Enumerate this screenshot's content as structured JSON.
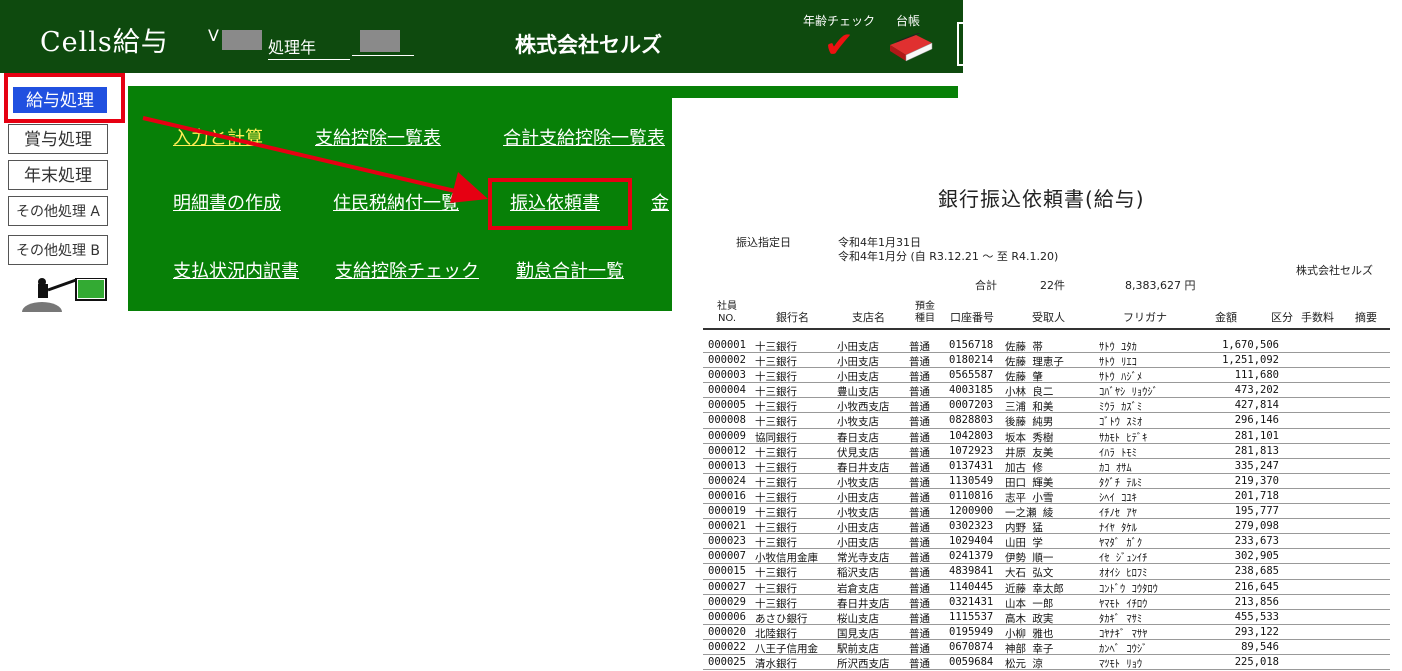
{
  "header": {
    "app_title": "Cells給与",
    "version_prefix": "V",
    "year_label": "処理年",
    "company": "株式会社セルズ",
    "age_check_label": "年齢チェック",
    "age_check_icon": "check-icon",
    "ledger_label": "台帳",
    "ledger_icon": "binder-icon"
  },
  "sidebar": {
    "items": [
      {
        "label": "給与処理",
        "active": true
      },
      {
        "label": "賞与処理"
      },
      {
        "label": "年末処理"
      },
      {
        "label": "その他処理 A"
      },
      {
        "label": "その他処理 B"
      }
    ]
  },
  "menu": {
    "row1": [
      "入力と計算",
      "支給控除一覧表",
      "合計支給控除一覧表"
    ],
    "row2": [
      "明細書の作成",
      "住民税納付一覧",
      "振込依頼書",
      "金"
    ],
    "row3": [
      "支払状況内訳書",
      "支給控除チェック",
      "勤怠合計一覧"
    ]
  },
  "colors": {
    "header_bg": "#0e4a0e",
    "menu_bg": "#078007",
    "highlight": "#e60012",
    "active_button": "#2050e0"
  },
  "report": {
    "title": "銀行振込依頼書(給与)",
    "date_label": "振込指定日",
    "date_value": "令和4年1月31日",
    "period": "令和4年1月分 (自 R3.12.21 ～ 至 R4.1.20)",
    "company": "株式会社セルズ",
    "total_label": "合計",
    "total_count": "22件",
    "total_amount": "8,383,627 円",
    "columns": [
      "社員NO.",
      "銀行名",
      "支店名",
      "預金種目",
      "口座番号",
      "受取人",
      "フリガナ",
      "金額",
      "区分",
      "手数料",
      "摘要"
    ],
    "rows": [
      [
        "000001",
        "十三銀行",
        "小田支店",
        "普通",
        "0156718",
        "佐藤 帯",
        "ｻﾄｳ ﾕﾀｶ",
        "1,670,506"
      ],
      [
        "000002",
        "十三銀行",
        "小田支店",
        "普通",
        "0180214",
        "佐藤 理恵子",
        "ｻﾄｳ ﾘｴｺ",
        "1,251,092"
      ],
      [
        "000003",
        "十三銀行",
        "小田支店",
        "普通",
        "0565587",
        "佐藤 肇",
        "ｻﾄｳ ﾊｼﾞﾒ",
        "111,680"
      ],
      [
        "000004",
        "十三銀行",
        "豊山支店",
        "普通",
        "4003185",
        "小林 良二",
        "ｺﾊﾞﾔｼ ﾘｮｳｼﾞ",
        "473,202"
      ],
      [
        "000005",
        "十三銀行",
        "小牧西支店",
        "普通",
        "0007203",
        "三浦 和美",
        "ﾐｳﾗ ｶｽﾞﾐ",
        "427,814"
      ],
      [
        "000008",
        "十三銀行",
        "小牧支店",
        "普通",
        "0828803",
        "後藤 純男",
        "ｺﾞﾄｳ ｽﾐｵ",
        "296,146"
      ],
      [
        "000009",
        "協同銀行",
        "春日支店",
        "普通",
        "1042803",
        "坂本 秀樹",
        "ｻｶﾓﾄ ﾋﾃﾞｷ",
        "281,101"
      ],
      [
        "000012",
        "十三銀行",
        "伏見支店",
        "普通",
        "1072923",
        "井原 友美",
        "ｲﾊﾗ ﾄﾓﾐ",
        "281,813"
      ],
      [
        "000013",
        "十三銀行",
        "春日井支店",
        "普通",
        "0137431",
        "加古 修",
        "ｶｺ ｵｻﾑ",
        "335,247"
      ],
      [
        "000024",
        "十三銀行",
        "小牧支店",
        "普通",
        "1130549",
        "田口 輝美",
        "ﾀｸﾞﾁ ﾃﾙﾐ",
        "219,370"
      ],
      [
        "000016",
        "十三銀行",
        "小田支店",
        "普通",
        "0110816",
        "志平 小雪",
        "ｼﾍｲ ｺﾕｷ",
        "201,718"
      ],
      [
        "000019",
        "十三銀行",
        "小牧支店",
        "普通",
        "1200900",
        "一之瀬 綾",
        "ｲﾁﾉｾ ｱﾔ",
        "195,777"
      ],
      [
        "000021",
        "十三銀行",
        "小田支店",
        "普通",
        "0302323",
        "内野 猛",
        "ﾅｲﾔ ﾀｹﾙ",
        "279,098"
      ],
      [
        "000023",
        "十三銀行",
        "小田支店",
        "普通",
        "1029404",
        "山田 学",
        "ﾔﾏﾀﾞ ｶﾞｸ",
        "233,673"
      ],
      [
        "000007",
        "小牧信用金庫",
        "常光寺支店",
        "普通",
        "0241379",
        "伊勢 順一",
        "ｲｾ ｼﾞｭﾝｲﾁ",
        "302,905"
      ],
      [
        "000015",
        "十三銀行",
        "稲沢支店",
        "普通",
        "4839841",
        "大石 弘文",
        "ｵｵｲｼ ﾋﾛﾌﾐ",
        "238,685"
      ],
      [
        "000027",
        "十三銀行",
        "岩倉支店",
        "普通",
        "1140445",
        "近藤 幸太郎",
        "ｺﾝﾄﾞｳ ｺｳﾀﾛｳ",
        "216,645"
      ],
      [
        "000029",
        "十三銀行",
        "春日井支店",
        "普通",
        "0321431",
        "山本 一郎",
        "ﾔﾏﾓﾄ ｲﾁﾛｳ",
        "213,856"
      ],
      [
        "000006",
        "あさひ銀行",
        "桜山支店",
        "普通",
        "1115537",
        "高木 政実",
        "ﾀｶｷﾞ ﾏｻﾐ",
        "455,533"
      ],
      [
        "000020",
        "北陸銀行",
        "国見支店",
        "普通",
        "0195949",
        "小柳 雅也",
        "ｺﾔﾅｷﾞ ﾏｻﾔ",
        "293,122"
      ],
      [
        "000022",
        "八王子信用金",
        "駅前支店",
        "普通",
        "0670874",
        "神部 幸子",
        "ｶﾝﾍﾞ ｺｳｼﾞ",
        "89,546"
      ],
      [
        "000025",
        "清水銀行",
        "所沢西支店",
        "普通",
        "0059684",
        "松元 涼",
        "ﾏﾂﾓﾄ ﾘｮｳ",
        "225,018"
      ]
    ]
  }
}
